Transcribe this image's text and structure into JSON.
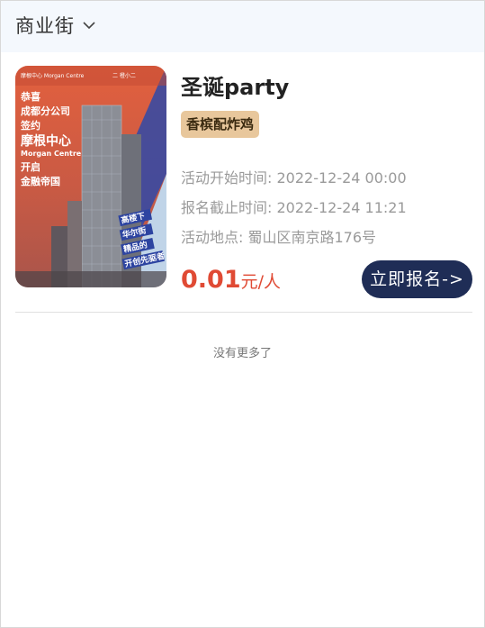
{
  "header": {
    "location": "商业街"
  },
  "event": {
    "title": "圣诞party",
    "tag": "香槟配炸鸡",
    "start_label": "活动开始时间: ",
    "start_value": "2022-12-24 00:00",
    "deadline_label": "报名截止时间: ",
    "deadline_value": "2022-12-24 11:21",
    "place_label": "活动地点: ",
    "place_value": "蜀山区南京路176号",
    "price": "0.01",
    "price_unit": "元/人",
    "signup_label": "立即报名->"
  },
  "poster": {
    "brand_left": "摩根中心 Morgan Centre",
    "brand_right": "二 橙小二",
    "line1": "恭喜",
    "line2": "成都分公司",
    "line3": "签约",
    "line4": "摩根中心",
    "line5": "Morgan Centre",
    "line6": "开启",
    "line7": "金融帝国",
    "badge1": "高楼下",
    "badge2": "华尔街",
    "badge3": "精品的",
    "badge4": "开创先驱者"
  },
  "footer": {
    "no_more": "没有更多了"
  }
}
